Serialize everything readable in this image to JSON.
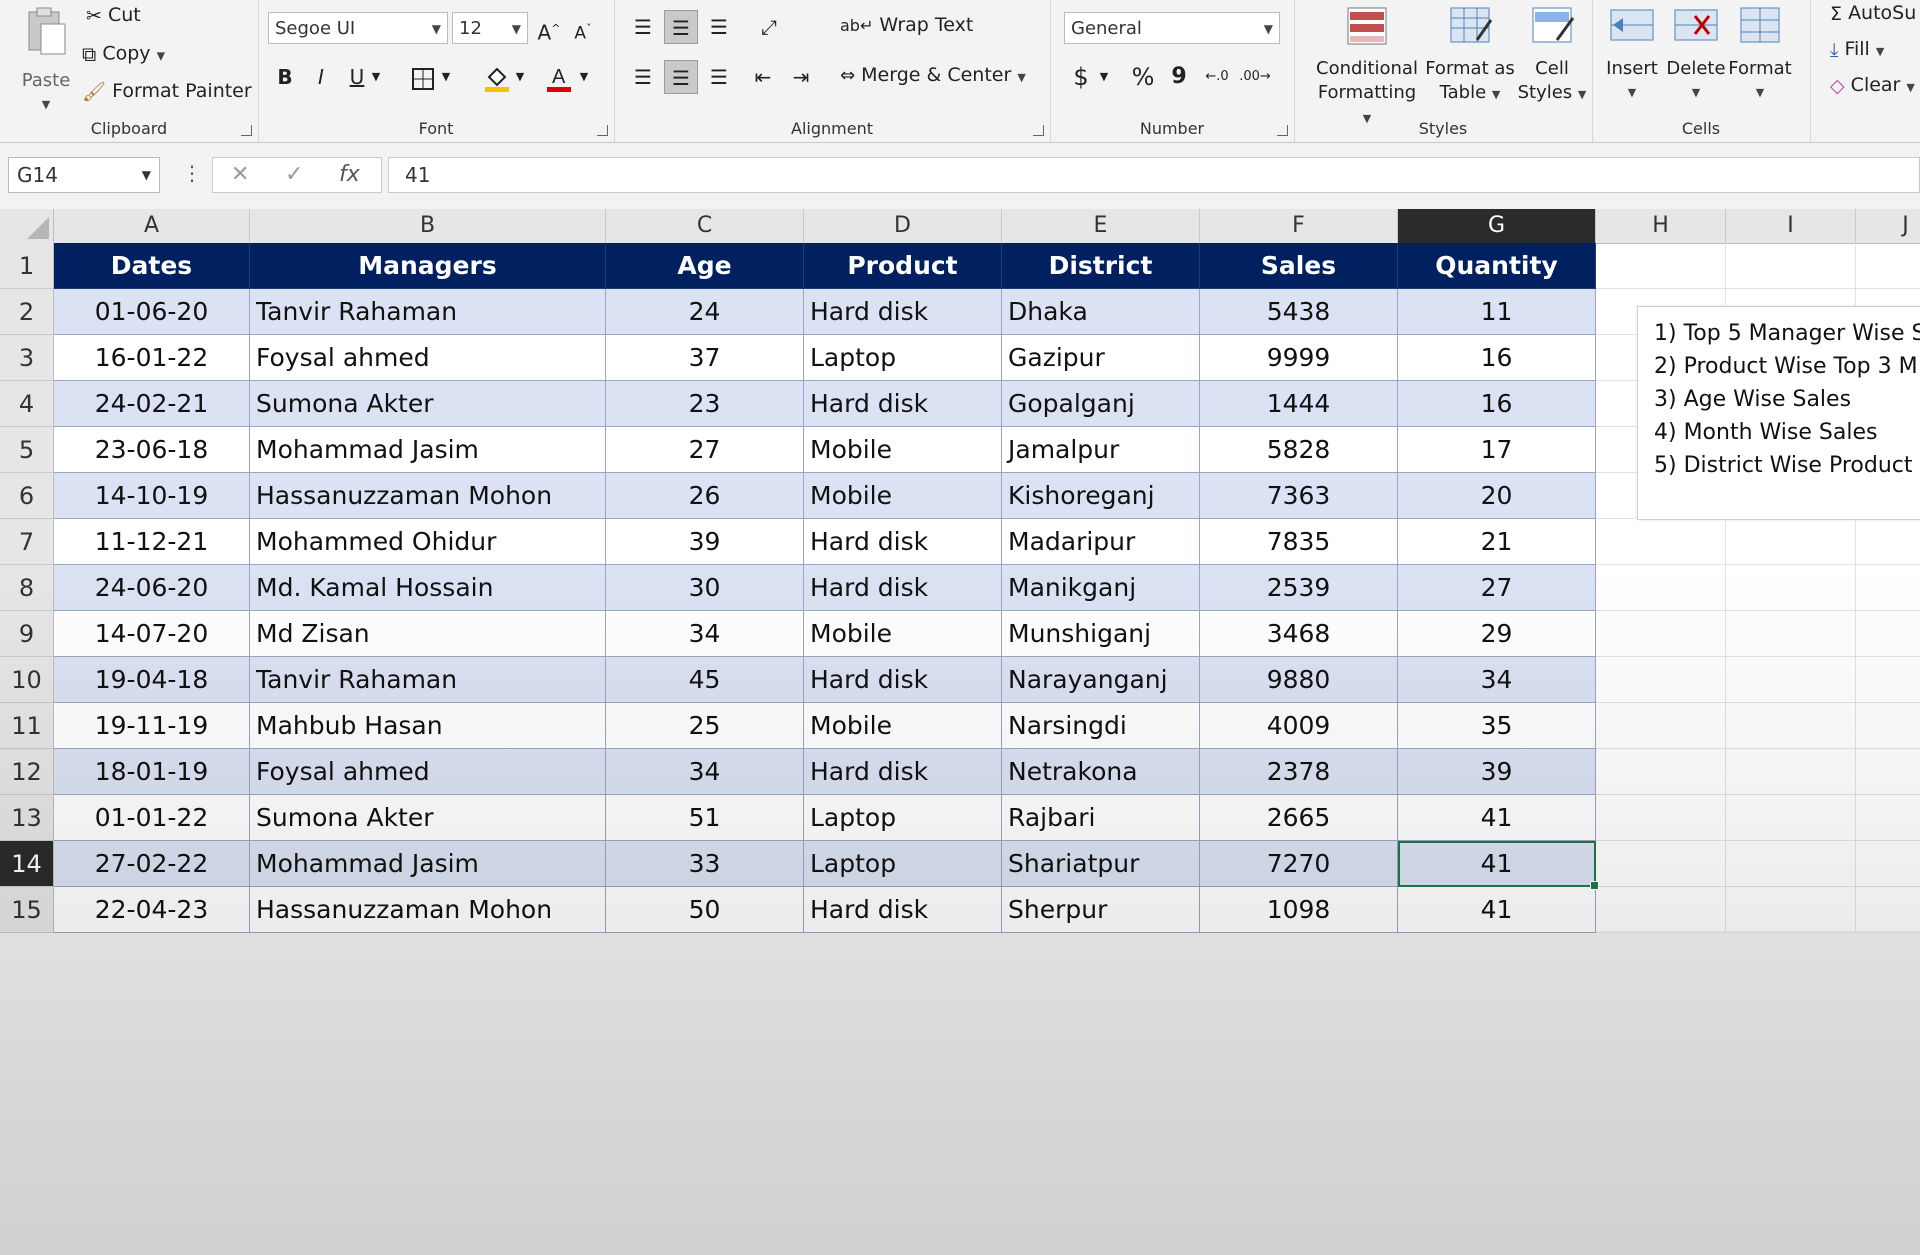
{
  "ribbon": {
    "clipboard": {
      "label": "Clipboard",
      "paste": "Paste",
      "cut": "Cut",
      "copy": "Copy",
      "format_painter": "Format Painter"
    },
    "font": {
      "label": "Font",
      "family": "Segoe UI",
      "size": "12",
      "bold": "B",
      "italic": "I",
      "underline": "U",
      "grow": "A",
      "shrink": "A"
    },
    "alignment": {
      "label": "Alignment",
      "wrap_text": "Wrap Text",
      "merge_center": "Merge & Center"
    },
    "number": {
      "label": "Number",
      "format": "General",
      "currency": "$",
      "percent": "%",
      "comma": "9"
    },
    "styles": {
      "label": "Styles",
      "conditional_formatting": [
        "Conditional",
        "Formatting"
      ],
      "format_as_table": [
        "Format as",
        "Table"
      ],
      "cell_styles": [
        "Cell",
        "Styles"
      ]
    },
    "cells": {
      "label": "Cells",
      "insert": "Insert",
      "delete": "Delete",
      "format": "Format"
    },
    "editing": {
      "autosum": "AutoSu",
      "fill": "Fill",
      "clear": "Clear"
    }
  },
  "formula_bar": {
    "name_box": "G14",
    "formula": "41"
  },
  "columns": [
    "A",
    "B",
    "C",
    "D",
    "E",
    "F",
    "G",
    "H",
    "I",
    "J"
  ],
  "selected": {
    "column": "G",
    "row": "14"
  },
  "table": {
    "headers": [
      "Dates",
      "Managers",
      "Age",
      "Product",
      "District",
      "Sales",
      "Quantity"
    ],
    "rows": [
      [
        "01-06-20",
        "Tanvir Rahaman",
        "24",
        "Hard disk",
        "Dhaka",
        "5438",
        "11"
      ],
      [
        "16-01-22",
        "Foysal ahmed",
        "37",
        "Laptop",
        "Gazipur",
        "9999",
        "16"
      ],
      [
        "24-02-21",
        "Sumona Akter",
        "23",
        "Hard disk",
        "Gopalganj",
        "1444",
        "16"
      ],
      [
        "23-06-18",
        "Mohammad Jasim",
        "27",
        "Mobile",
        "Jamalpur",
        "5828",
        "17"
      ],
      [
        "14-10-19",
        "Hassanuzzaman Mohon",
        "26",
        "Mobile",
        "Kishoreganj",
        "7363",
        "20"
      ],
      [
        "11-12-21",
        "Mohammed Ohidur",
        "39",
        "Hard disk",
        "Madaripur",
        "7835",
        "21"
      ],
      [
        "24-06-20",
        "Md. Kamal Hossain",
        "30",
        "Hard disk",
        "Manikganj",
        "2539",
        "27"
      ],
      [
        "14-07-20",
        "Md Zisan",
        "34",
        "Mobile",
        "Munshiganj",
        "3468",
        "29"
      ],
      [
        "19-04-18",
        "Tanvir Rahaman",
        "45",
        "Hard disk",
        "Narayanganj",
        "9880",
        "34"
      ],
      [
        "19-11-19",
        "Mahbub Hasan",
        "25",
        "Mobile",
        "Narsingdi",
        "4009",
        "35"
      ],
      [
        "18-01-19",
        "Foysal ahmed",
        "34",
        "Hard disk",
        "Netrakona",
        "2378",
        "39"
      ],
      [
        "01-01-22",
        "Sumona Akter",
        "51",
        "Laptop",
        "Rajbari",
        "2665",
        "41"
      ],
      [
        "27-02-22",
        "Mohammad Jasim",
        "33",
        "Laptop",
        "Shariatpur",
        "7270",
        "41"
      ],
      [
        "22-04-23",
        "Hassanuzzaman Mohon",
        "50",
        "Hard disk",
        "Sherpur",
        "1098",
        "41"
      ]
    ]
  },
  "notes": [
    "1) Top 5 Manager Wise S",
    "2) Product Wise Top 3 M",
    "3) Age Wise Sales",
    "4) Month Wise Sales",
    "5) District Wise Product C"
  ],
  "colors": {
    "header_bg": "#002060",
    "band_a": "#dbe2f3",
    "band_b": "#ffffff",
    "selection": "#1e7145"
  }
}
